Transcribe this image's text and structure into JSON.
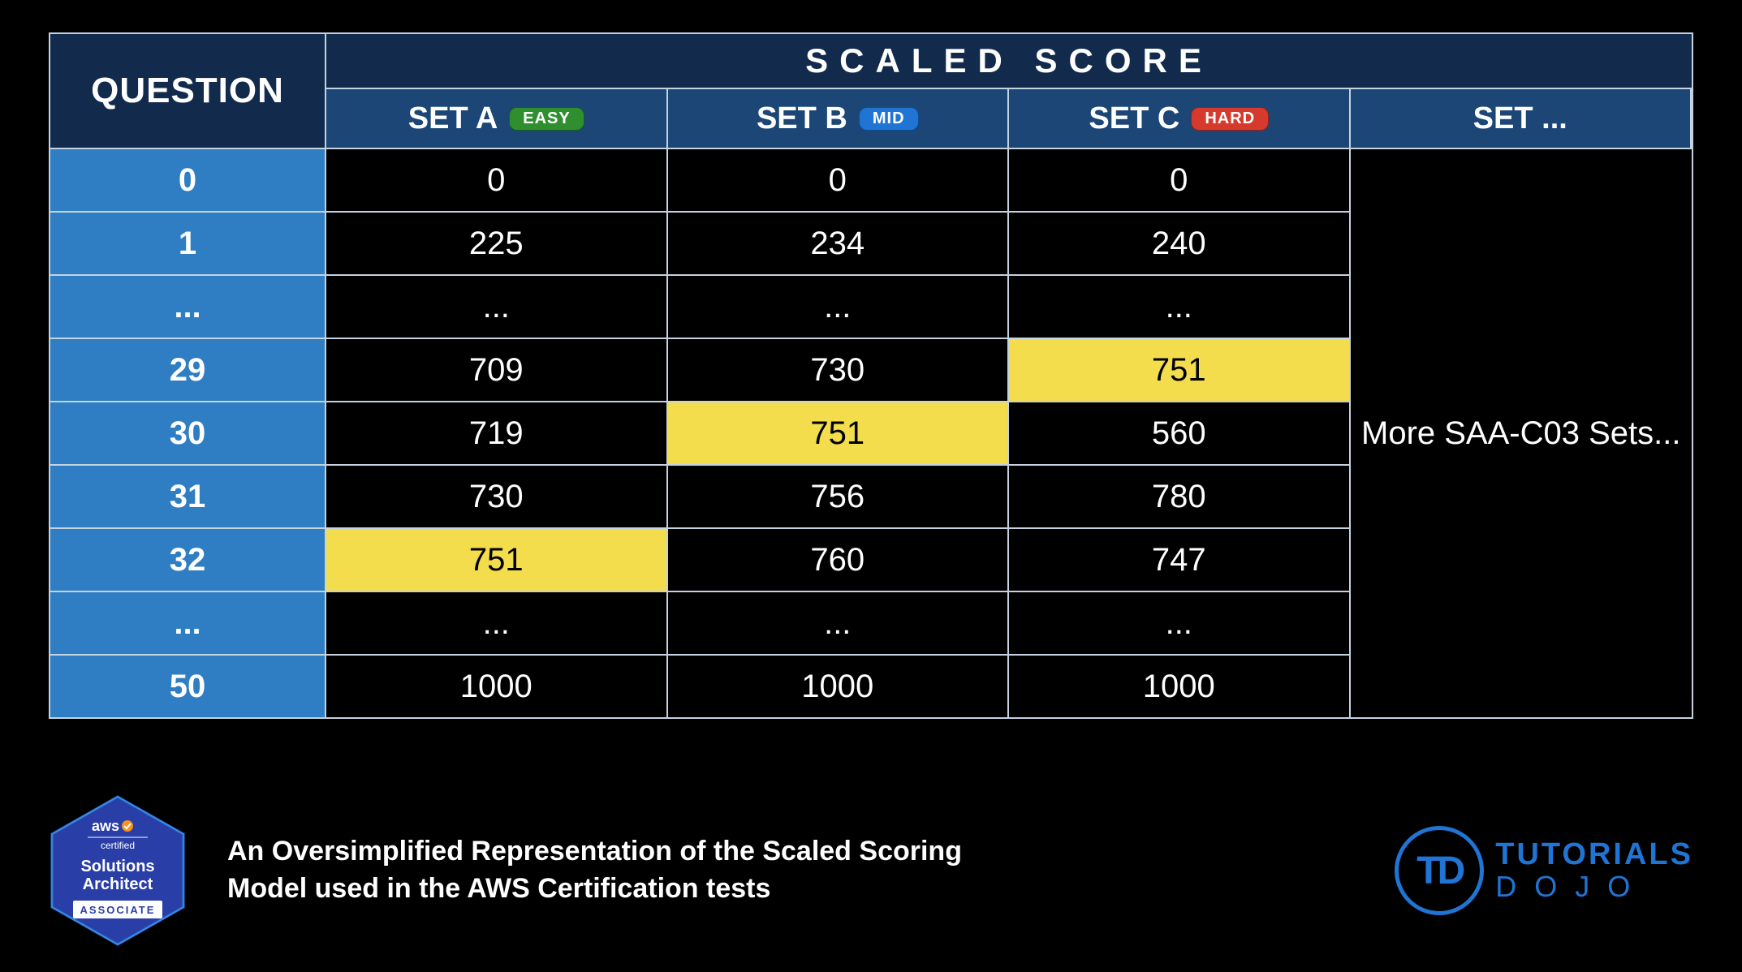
{
  "header": {
    "question_label": "QUESTION",
    "scaled_score_label": "SCALED  SCORE",
    "sets": [
      {
        "label": "SET A",
        "difficulty": "EASY",
        "badge_class": "badge-easy"
      },
      {
        "label": "SET B",
        "difficulty": "MID",
        "badge_class": "badge-mid"
      },
      {
        "label": "SET C",
        "difficulty": "HARD",
        "badge_class": "badge-hard"
      },
      {
        "label": "SET ...",
        "difficulty": null
      }
    ]
  },
  "rows": [
    {
      "q": "0",
      "a": "0",
      "b": "0",
      "c": "0"
    },
    {
      "q": "1",
      "a": "225",
      "b": "234",
      "c": "240"
    },
    {
      "q": "...",
      "a": "...",
      "b": "...",
      "c": "..."
    },
    {
      "q": "29",
      "a": "709",
      "b": "730",
      "c": "751",
      "hl": [
        "c"
      ]
    },
    {
      "q": "30",
      "a": "719",
      "b": "751",
      "c": "560",
      "hl": [
        "b"
      ]
    },
    {
      "q": "31",
      "a": "730",
      "b": "756",
      "c": "780"
    },
    {
      "q": "32",
      "a": "751",
      "b": "760",
      "c": "747",
      "hl": [
        "a"
      ]
    },
    {
      "q": "...",
      "a": "...",
      "b": "...",
      "c": "..."
    },
    {
      "q": "50",
      "a": "1000",
      "b": "1000",
      "c": "1000"
    }
  ],
  "more_sets_label": "More SAA-C03 Sets...",
  "footer": {
    "caption": "An Oversimplified Representation of the Scaled Scoring Model used in the AWS Certification tests",
    "aws_badge": {
      "top": "aws",
      "certified": "certified",
      "line1": "Solutions",
      "line2": "Architect",
      "tier": "ASSOCIATE"
    },
    "td_logo": {
      "mark": "TD",
      "line1": "TUTORIALS",
      "line2": "DOJO"
    }
  },
  "chart_data": {
    "type": "table",
    "title": "Scaled Score by Question Count and Set Difficulty",
    "columns": [
      "QUESTION",
      "SET A (EASY)",
      "SET B (MID)",
      "SET C (HARD)"
    ],
    "rows": [
      [
        "0",
        0,
        0,
        0
      ],
      [
        "1",
        225,
        234,
        240
      ],
      [
        "29",
        709,
        730,
        751
      ],
      [
        "30",
        719,
        751,
        560
      ],
      [
        "31",
        730,
        756,
        780
      ],
      [
        "32",
        751,
        760,
        747
      ],
      [
        "50",
        1000,
        1000,
        1000
      ]
    ],
    "highlighted_cells": [
      {
        "question": "29",
        "set": "C",
        "value": 751
      },
      {
        "question": "30",
        "set": "B",
        "value": 751
      },
      {
        "question": "32",
        "set": "A",
        "value": 751
      }
    ]
  }
}
